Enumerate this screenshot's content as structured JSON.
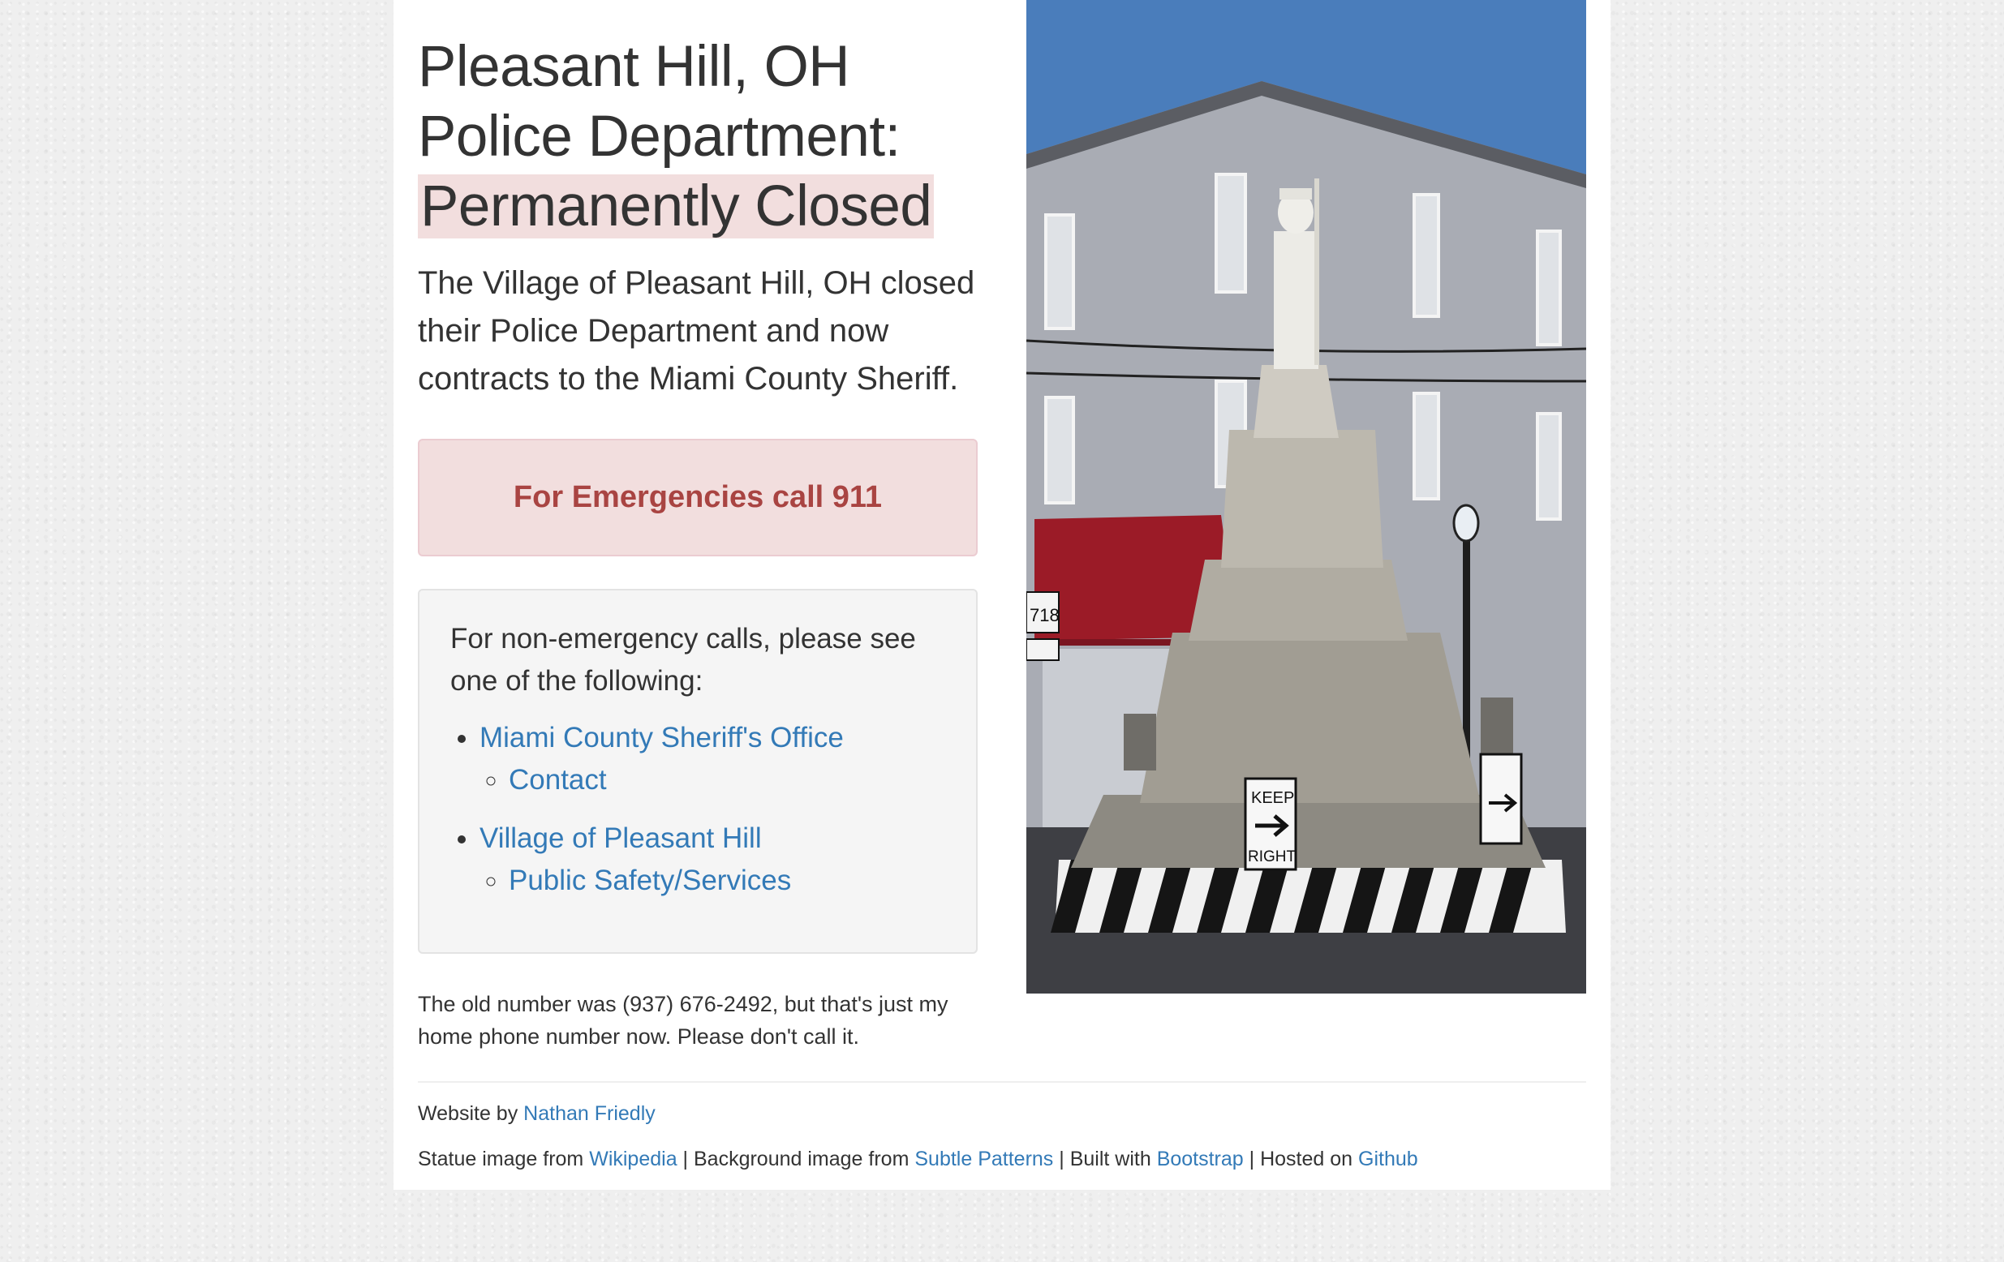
{
  "header": {
    "title_line1": "Pleasant Hill, OH",
    "title_line2": "Police Department:",
    "title_highlight": "Permanently Closed"
  },
  "lead": "The Village of Pleasant Hill, OH closed their Police Department and now contracts to the Miami County Sheriff.",
  "emergency": {
    "text": "For Emergencies call 911",
    "color": "#a94442",
    "background": "#f2dede"
  },
  "non_emergency": {
    "intro": "For non-emergency calls, please see one of the following:",
    "items": [
      {
        "label": "Miami County Sheriff's Office",
        "sub": [
          {
            "label": "Contact"
          }
        ]
      },
      {
        "label": "Village of Pleasant Hill",
        "sub": [
          {
            "label": "Public Safety/Services"
          }
        ]
      }
    ]
  },
  "note": "The old number was (937) 676-2492, but that's just my home phone number now. Please don't call it.",
  "photo": {
    "sign_route": "718",
    "sign_keep": "KEEP",
    "sign_right": "RIGHT"
  },
  "footer": {
    "credit_prefix": "Website by",
    "credit_name": "Nathan Friedly",
    "statue_prefix": "Statue image from",
    "statue_link": "Wikipedia",
    "bg_prefix": "| Background image from",
    "bg_link": "Subtle Patterns",
    "built_prefix": "| Built with",
    "built_link": "Bootstrap",
    "hosted_prefix": "| Hosted on",
    "hosted_link": "Github"
  },
  "colors": {
    "link": "#337ab7",
    "text": "#333333",
    "highlight": "#f2dede"
  }
}
